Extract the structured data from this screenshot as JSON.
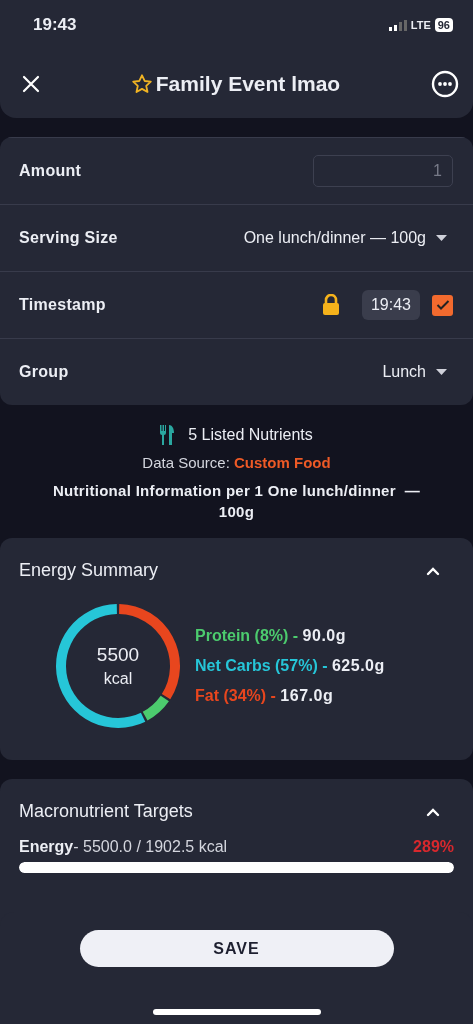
{
  "status_bar": {
    "time": "19:43",
    "network": "LTE",
    "battery": "96"
  },
  "header": {
    "title": "Family Event lmao",
    "favorite": false
  },
  "form": {
    "rows": [
      {
        "kind": "input",
        "label": "Amount",
        "placeholder": "1"
      },
      {
        "kind": "dropdown",
        "label": "Serving Size",
        "value": "One lunch/dinner  — 100g"
      },
      {
        "kind": "timestamp",
        "label": "Timestamp",
        "locked": true,
        "time": "19:43",
        "checked": true
      },
      {
        "kind": "dropdown",
        "label": "Group",
        "value": "Lunch"
      }
    ]
  },
  "info": {
    "nutrients": "5 Listed Nutrients",
    "source_label": "Data Source:",
    "source": "Custom Food",
    "per": "Nutritional Information per 1 One lunch/dinner  — 100g"
  },
  "energy_summary": {
    "title": "Energy Summary",
    "expanded": true,
    "total": "5500",
    "unit": "kcal",
    "macros": [
      {
        "name": "Protein (8%) -",
        "value": "90.0g",
        "color": "#4ccb6e"
      },
      {
        "name": "Net Carbs (57%) -",
        "value": "625.0g",
        "color": "#26c6d8"
      },
      {
        "name": "Fat (34%) -",
        "value": "167.0g",
        "color": "#e8461e"
      }
    ],
    "chart_data": {
      "type": "donut",
      "colors": [
        "#e8461e",
        "#4ccb6e",
        "#26c6d8"
      ],
      "values": [
        34,
        8,
        57
      ]
    }
  },
  "targets": {
    "title": "Macronutrient Targets",
    "expanded": true,
    "items": [
      {
        "name": "Energy",
        "amount": "- 5500.0 / 1902.5 kcal",
        "percent": "289%",
        "level": 1
      }
    ]
  },
  "save": {
    "label": "SAVE"
  }
}
